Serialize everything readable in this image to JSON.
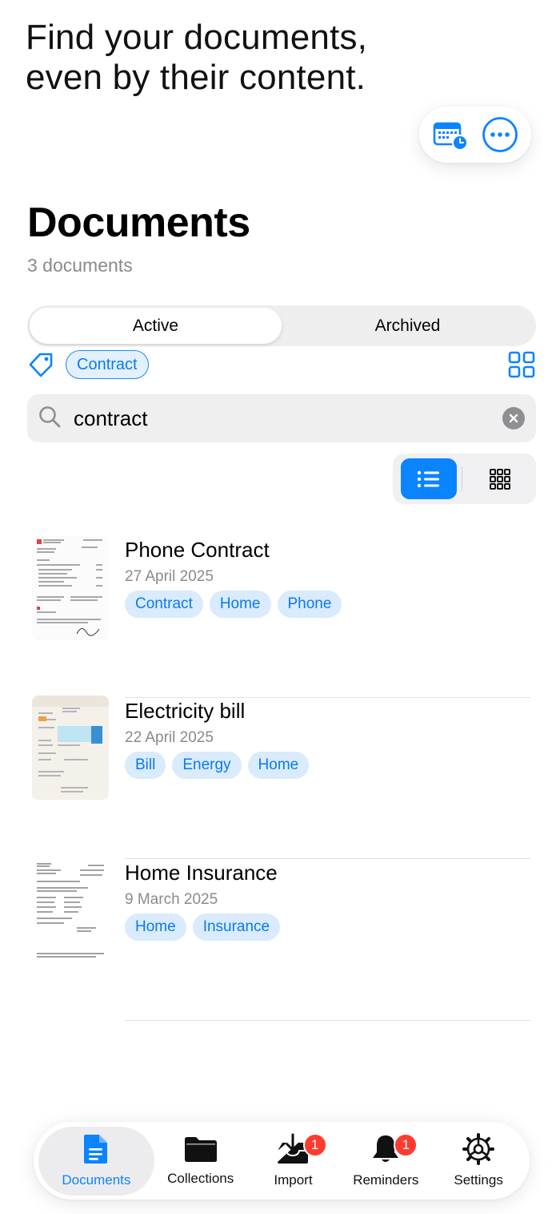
{
  "promo": {
    "text": "Find your documents,\neven by their content."
  },
  "top_actions": {
    "icons": [
      "calendar-clock-icon",
      "ellipsis-circle-icon"
    ]
  },
  "header": {
    "title": "Documents",
    "count_text": "3 documents"
  },
  "segments": {
    "active_label": "Active",
    "archived_label": "Archived",
    "selected": "Active"
  },
  "filters": {
    "chip_label": "Contract"
  },
  "search": {
    "value": "contract",
    "placeholder": ""
  },
  "view_mode": {
    "selected": "list"
  },
  "documents": [
    {
      "title": "Phone Contract",
      "date": "27 April 2025",
      "tags": [
        "Contract",
        "Home",
        "Phone"
      ]
    },
    {
      "title": "Electricity bill",
      "date": "22 April 2025",
      "tags": [
        "Bill",
        "Energy",
        "Home"
      ]
    },
    {
      "title": "Home Insurance",
      "date": "9 March 2025",
      "tags": [
        "Home",
        "Insurance"
      ]
    }
  ],
  "tabbar": {
    "selected": "Documents",
    "items": [
      {
        "label": "Documents",
        "icon": "document-icon",
        "badge": null
      },
      {
        "label": "Collections",
        "icon": "folder-icon",
        "badge": null
      },
      {
        "label": "Import",
        "icon": "tray-download-icon",
        "badge": "1"
      },
      {
        "label": "Reminders",
        "icon": "bell-icon",
        "badge": "1"
      },
      {
        "label": "Settings",
        "icon": "gear-icon",
        "badge": null
      }
    ]
  },
  "colors": {
    "accent": "#0a84ff",
    "tag_bg": "#d9ebfc",
    "badge": "#ff3b30",
    "secondary_text": "#8a8a8e"
  }
}
